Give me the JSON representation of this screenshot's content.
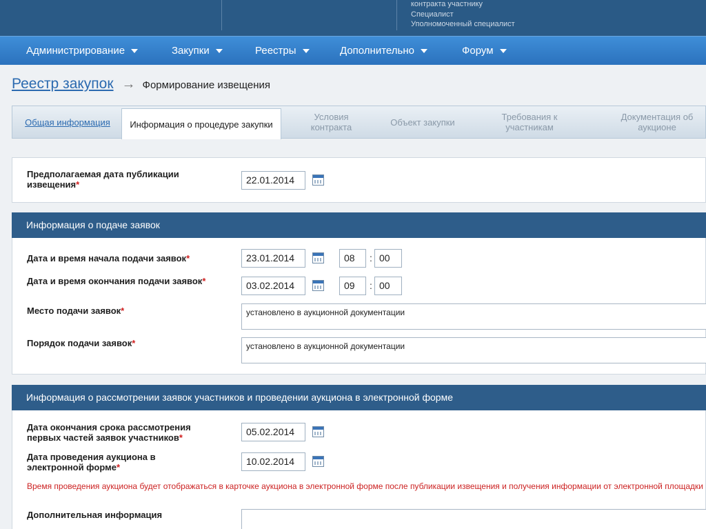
{
  "user": {
    "line1": "контракта участнику",
    "line2": "Специалист",
    "line3": "Уполномоченный специалист"
  },
  "nav": [
    {
      "label": "Администрирование"
    },
    {
      "label": "Закупки"
    },
    {
      "label": "Реестры"
    },
    {
      "label": "Дополнительно"
    },
    {
      "label": "Форум"
    }
  ],
  "breadcrumb": {
    "link": "Реестр закупок",
    "arrow": "→",
    "current": "Формирование извещения"
  },
  "tabs": [
    {
      "label": "Общая информация",
      "state": "link"
    },
    {
      "label": "Информация о процедуре закупки",
      "state": "active"
    },
    {
      "label": "Условия контракта",
      "state": "disabled"
    },
    {
      "label": "Объект закупки",
      "state": "disabled"
    },
    {
      "label": "Требования к участникам",
      "state": "disabled"
    },
    {
      "label": "Документация об аукционе",
      "state": "disabled"
    }
  ],
  "publication": {
    "label": "Предполагаемая дата публикации извещения",
    "required": "*",
    "date": "22.01.2014"
  },
  "submission": {
    "title": "Информация о подаче заявок",
    "start_label": "Дата и время начала подачи заявок",
    "start_date": "23.01.2014",
    "start_hour": "08",
    "start_minute": "00",
    "end_label": "Дата и время окончания подачи заявок",
    "end_date": "03.02.2014",
    "end_hour": "09",
    "end_minute": "00",
    "time_sep": ":",
    "place_label": "Место подачи заявок",
    "place_value": "установлено в аукционной документации",
    "order_label": "Порядок подачи заявок",
    "order_value": "установлено в аукционной документации",
    "required": "*"
  },
  "review": {
    "title": "Информация о рассмотрении заявок участников и проведении аукциона в электронной форме",
    "review_end_label": "Дата окончания срока рассмотрения первых частей заявок участников",
    "review_end_date": "05.02.2014",
    "auction_label": "Дата проведения аукциона в электронной форме",
    "auction_date": "10.02.2014",
    "note": "Время проведения аукциона будет отображаться в карточке аукциона в электронной форме после публикации извещения и получения информации от электронной площадки",
    "extra_label": "Дополнительная информация",
    "extra_value": "",
    "required": "*"
  },
  "colors": {
    "topbar": "#2a5a86",
    "navbar": "#2f7bc8",
    "section_header": "#2e5d8a",
    "link": "#2b6ab0",
    "required": "#d02020"
  }
}
